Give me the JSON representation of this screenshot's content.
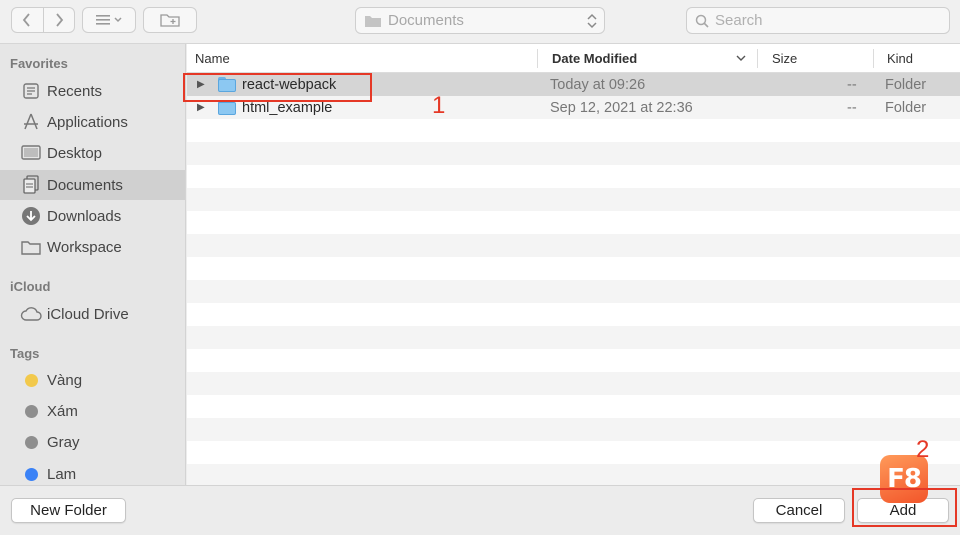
{
  "toolbar": {
    "back_icon": "chevron-left-icon",
    "forward_icon": "chevron-right-icon",
    "view_icon": "list-view-icon",
    "new_folder_icon": "folder-plus-icon",
    "location": "Documents",
    "search_placeholder": "Search"
  },
  "sidebar": {
    "favorites_title": "Favorites",
    "favorites": [
      {
        "label": "Recents",
        "icon": "clock-icon"
      },
      {
        "label": "Applications",
        "icon": "applications-icon"
      },
      {
        "label": "Desktop",
        "icon": "desktop-icon"
      },
      {
        "label": "Documents",
        "icon": "document-icon"
      },
      {
        "label": "Downloads",
        "icon": "download-icon"
      },
      {
        "label": "Workspace",
        "icon": "folder-icon"
      }
    ],
    "icloud_title": "iCloud",
    "icloud": [
      {
        "label": "iCloud Drive",
        "icon": "cloud-icon"
      }
    ],
    "tags_title": "Tags",
    "tags": [
      {
        "label": "Vàng",
        "color": "#f2c94c"
      },
      {
        "label": "Xám",
        "color": "#8e8e8e"
      },
      {
        "label": "Gray",
        "color": "#8e8e8e"
      },
      {
        "label": "Lam",
        "color": "#3b82f6"
      }
    ]
  },
  "columns": {
    "name": "Name",
    "date": "Date Modified",
    "size": "Size",
    "kind": "Kind"
  },
  "files": [
    {
      "name": "react-webpack",
      "date": "Today at 09:26",
      "size": "--",
      "kind": "Folder"
    },
    {
      "name": "html_example",
      "date": "Sep 12, 2021 at 22:36",
      "size": "--",
      "kind": "Folder"
    }
  ],
  "annotations": {
    "step1": "1",
    "step2": "2"
  },
  "logo_text": "F8",
  "buttons": {
    "new_folder": "New Folder",
    "cancel": "Cancel",
    "add": "Add"
  },
  "colors": {
    "annotation": "#e53826",
    "logo": "#f2552a"
  }
}
